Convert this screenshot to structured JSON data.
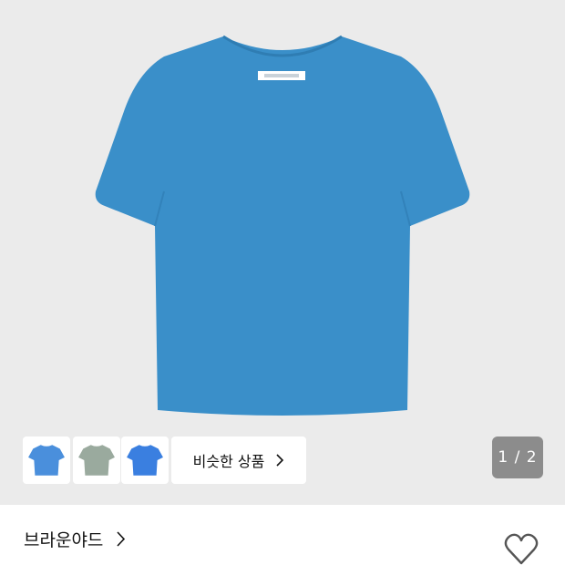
{
  "product": {
    "image_icon": "tshirt-blue",
    "shirt_color": "#3a8fc9",
    "thumbnails": [
      {
        "icon": "tshirt-blue",
        "color": "#4a8fdc"
      },
      {
        "icon": "tshirt-sage",
        "color": "#9aaa9e"
      },
      {
        "icon": "tshirt-bright-blue",
        "color": "#3a7fe0"
      }
    ],
    "similar_button_label": "비슷한 상품",
    "page_counter": "1 / 2"
  },
  "brand": {
    "name": "브라운야드"
  },
  "actions": {
    "wishlist_icon": "heart-outline-icon"
  }
}
